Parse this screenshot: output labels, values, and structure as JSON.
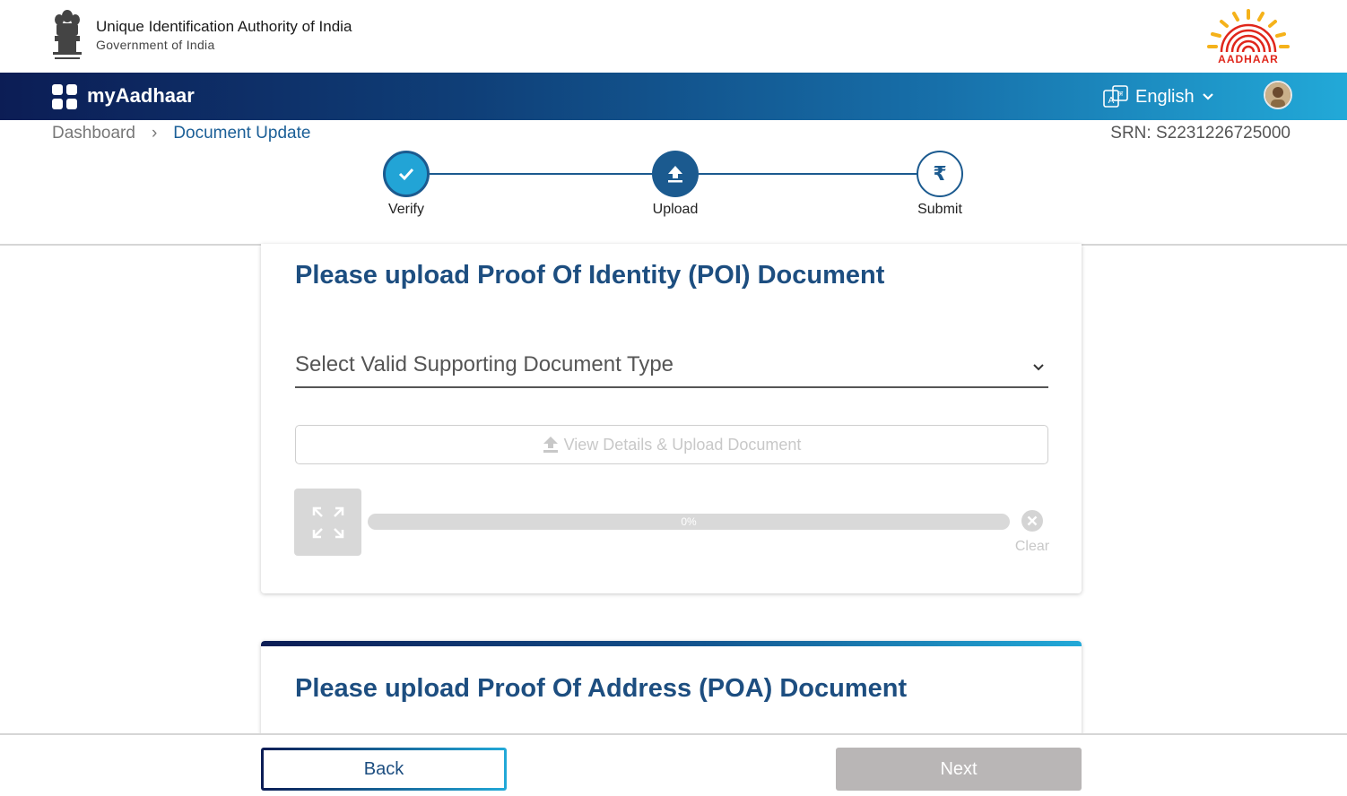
{
  "header": {
    "org_name": "Unique Identification Authority of India",
    "org_sub": "Government of India",
    "logo_text": "AADHAAR",
    "emblem_icon": "ashoka-emblem-icon"
  },
  "navbar": {
    "brand": "myAadhaar",
    "language": "English",
    "language_icon": "translate-icon",
    "gradient": [
      "#0c1d55",
      "#1770aa",
      "#22a9d8"
    ]
  },
  "breadcrumb": {
    "home": "Dashboard",
    "separator": "›",
    "current": "Document Update"
  },
  "srn": "SRN: S2231226725000",
  "stepper": {
    "steps": [
      {
        "label": "Verify",
        "state": "completed",
        "icon": "check-icon"
      },
      {
        "label": "Upload",
        "state": "active",
        "icon": "upload-icon"
      },
      {
        "label": "Submit",
        "state": "pending",
        "icon": "rupee-icon"
      }
    ]
  },
  "poi": {
    "title": "Please upload Proof Of Identity (POI) Document",
    "select_placeholder": "Select Valid Supporting Document Type",
    "upload_label": "View Details & Upload Document",
    "progress": 0,
    "progress_text": "0%",
    "clear_label": "Clear"
  },
  "poa": {
    "title": "Please upload Proof Of Address (POA) Document"
  },
  "footer": {
    "back_label": "Back",
    "next_label": "Next"
  },
  "colors": {
    "primary": "#1b5a8f",
    "title": "#1d4e80",
    "accent": "#22a9d8",
    "disabled": "#b9b6b6"
  }
}
